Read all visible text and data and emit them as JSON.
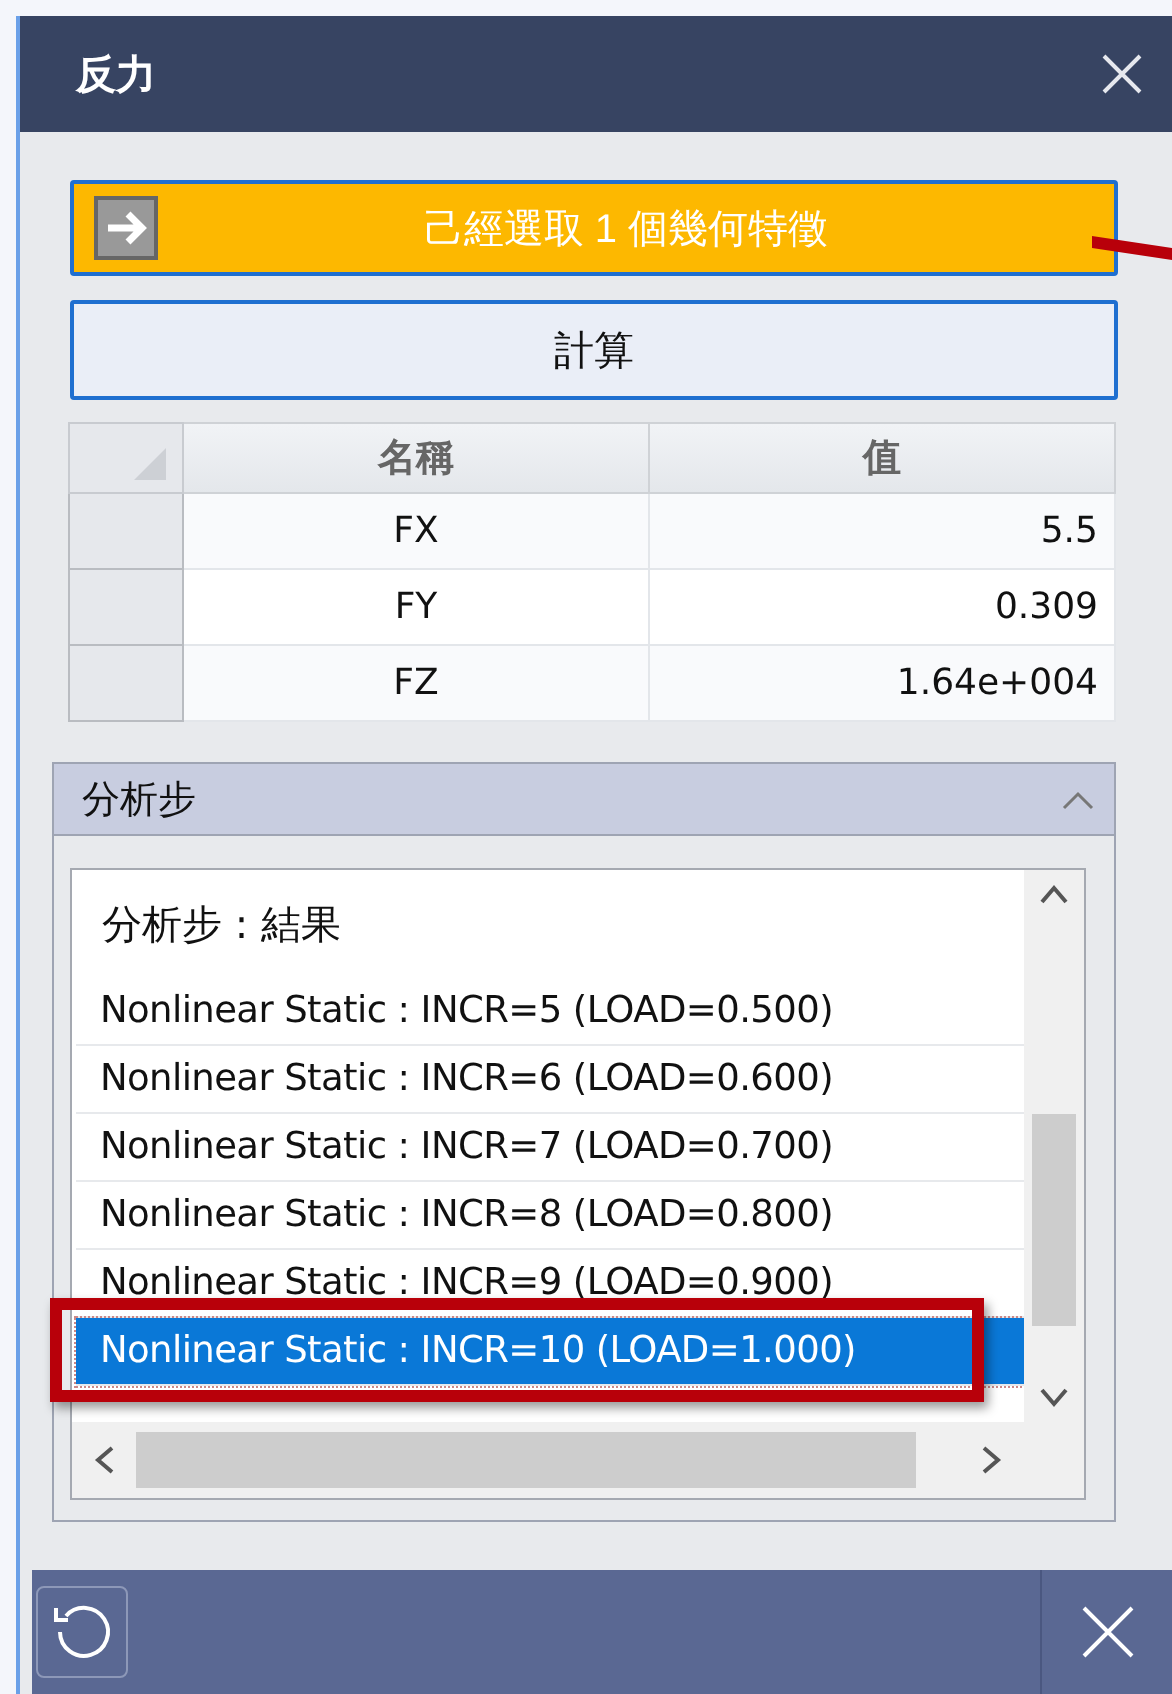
{
  "window": {
    "title": "反力"
  },
  "selection_button": {
    "label": "己經選取 1 個幾何特徵"
  },
  "compute_button": {
    "label": "計算"
  },
  "table": {
    "columns": [
      "名稱",
      "值"
    ],
    "rows": [
      {
        "name": "FX",
        "value": "5.5"
      },
      {
        "name": "FY",
        "value": "0.309"
      },
      {
        "name": "FZ",
        "value": "1.64e+004"
      }
    ]
  },
  "section": {
    "title": "分析步",
    "expanded": true
  },
  "list": {
    "header": "分析步 : 結果",
    "items": [
      {
        "label": "Nonlinear Static : INCR=5 (LOAD=0.500)",
        "selected": false
      },
      {
        "label": "Nonlinear Static : INCR=6 (LOAD=0.600)",
        "selected": false
      },
      {
        "label": "Nonlinear Static : INCR=7 (LOAD=0.700)",
        "selected": false
      },
      {
        "label": "Nonlinear Static : INCR=8 (LOAD=0.800)",
        "selected": false
      },
      {
        "label": "Nonlinear Static : INCR=9 (LOAD=0.900)",
        "selected": false
      },
      {
        "label": "Nonlinear Static : INCR=10 (LOAD=1.000)",
        "selected": true
      }
    ]
  }
}
